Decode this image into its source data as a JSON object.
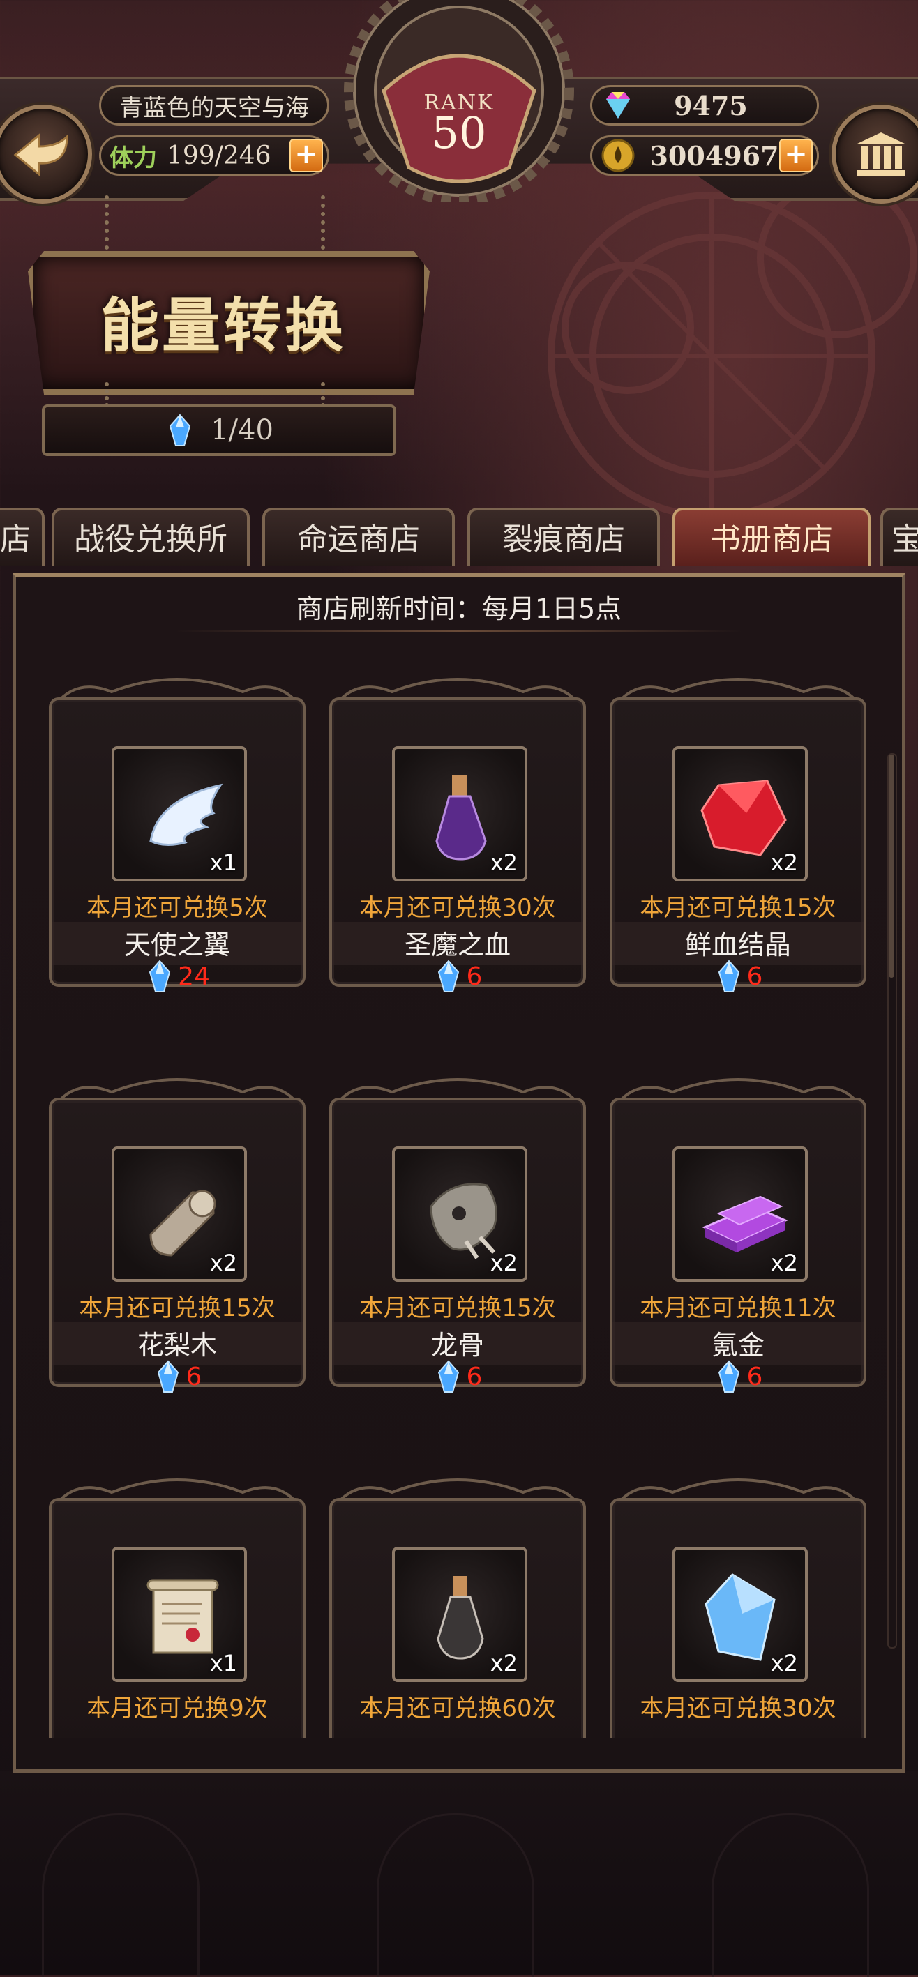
{
  "header": {
    "player_name": "青蓝色的天空与海",
    "stamina_label": "体力",
    "stamina_value": "199/246",
    "rank_label": "RANK",
    "rank_value": "50",
    "gems": "9475",
    "gold": "3004967",
    "plus": "+"
  },
  "banner": {
    "title": "能量转换",
    "energy_value": "1/40"
  },
  "tabs": [
    {
      "label": "店"
    },
    {
      "label": "战役兑换所"
    },
    {
      "label": "命运商店"
    },
    {
      "label": "裂痕商店"
    },
    {
      "label": "书册商店",
      "active": true
    },
    {
      "label": "宝"
    }
  ],
  "shop": {
    "refresh_text": "商店刷新时间：每月1日5点",
    "items": [
      {
        "name": "天使之翼",
        "qty": "x1",
        "limit": "本月还可兑换5次",
        "price": "24",
        "icon": "angel-wing-icon"
      },
      {
        "name": "圣魔之血",
        "qty": "x2",
        "limit": "本月还可兑换30次",
        "price": "6",
        "icon": "purple-potion-icon"
      },
      {
        "name": "鲜血结晶",
        "qty": "x2",
        "limit": "本月还可兑换15次",
        "price": "6",
        "icon": "red-crystal-icon"
      },
      {
        "name": "花梨木",
        "qty": "x2",
        "limit": "本月还可兑换15次",
        "price": "6",
        "icon": "wood-log-icon"
      },
      {
        "name": "龙骨",
        "qty": "x2",
        "limit": "本月还可兑换15次",
        "price": "6",
        "icon": "dragon-bone-icon"
      },
      {
        "name": "氪金",
        "qty": "x2",
        "limit": "本月还可兑换11次",
        "price": "6",
        "icon": "purple-ingot-icon"
      },
      {
        "name": "",
        "qty": "x1",
        "limit": "本月还可兑换9次",
        "price": "",
        "icon": "scroll-icon"
      },
      {
        "name": "",
        "qty": "x2",
        "limit": "本月还可兑换60次",
        "price": "",
        "icon": "clear-potion-icon"
      },
      {
        "name": "",
        "qty": "x2",
        "limit": "本月还可兑换30次",
        "price": "",
        "icon": "blue-crystal-icon"
      }
    ]
  },
  "colors": {
    "accent_orange": "#f0a63a",
    "price_red": "#ff2a1a",
    "stamina_green": "#9ed05b",
    "active_tab": "#8a3d33"
  }
}
